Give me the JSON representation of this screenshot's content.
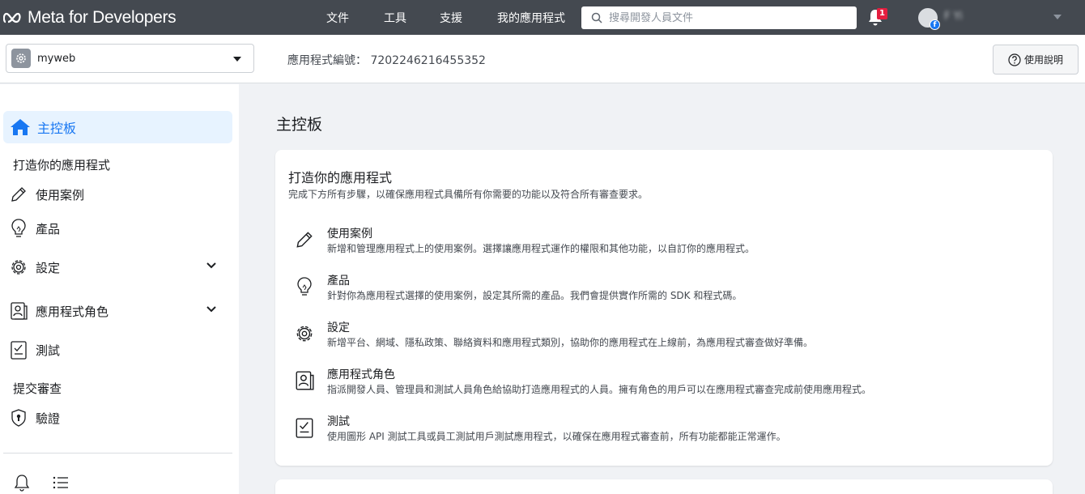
{
  "header": {
    "logo_text": "Meta for Developers",
    "nav": [
      "文件",
      "工具",
      "支援",
      "我的應用程式"
    ],
    "search_placeholder": "搜尋開發人員文件",
    "notification_count": "1",
    "user_name": "F        Yi"
  },
  "subbar": {
    "app_name": "myweb",
    "app_id_label": "應用程式編號： 7202246216455352",
    "help_label": "使用說明"
  },
  "sidebar": {
    "active": "主控板",
    "section_build": "打造你的應用程式",
    "items": [
      {
        "label": "使用案例",
        "icon": "pencil-icon"
      },
      {
        "label": "產品",
        "icon": "lightbulb-icon"
      },
      {
        "label": "設定",
        "icon": "gear-icon"
      },
      {
        "label": "應用程式角色",
        "icon": "id-card-icon"
      },
      {
        "label": "測試",
        "icon": "checklist-icon"
      }
    ],
    "section_submit": "提交審查",
    "verify_label": "驗證"
  },
  "main": {
    "title": "主控板",
    "card": {
      "title": "打造你的應用程式",
      "subtitle": "完成下方所有步驟，以確保應用程式具備所有你需要的功能以及符合所有審查要求。",
      "steps": [
        {
          "title": "使用案例",
          "desc": "新增和管理應用程式上的使用案例。選擇讓應用程式運作的權限和其他功能，以自訂你的應用程式。"
        },
        {
          "title": "產品",
          "desc": "針對你為應用程式選擇的使用案例，設定其所需的產品。我們會提供實作所需的 SDK 和程式碼。"
        },
        {
          "title": "設定",
          "desc": "新增平台、網域、隱私政策、聯絡資料和應用程式類別，協助你的應用程式在上線前，為應用程式審查做好準備。"
        },
        {
          "title": "應用程式角色",
          "desc": "指派開發人員、管理員和測試人員角色給協助打造應用程式的人員。擁有角色的用戶可以在應用程式審查完成前使用應用程式。"
        },
        {
          "title": "測試",
          "desc": "使用圖形 API 測試工具或員工測試用戶測試應用程式，以確保在應用程式審查前，所有功能都能正常運作。"
        }
      ]
    }
  }
}
